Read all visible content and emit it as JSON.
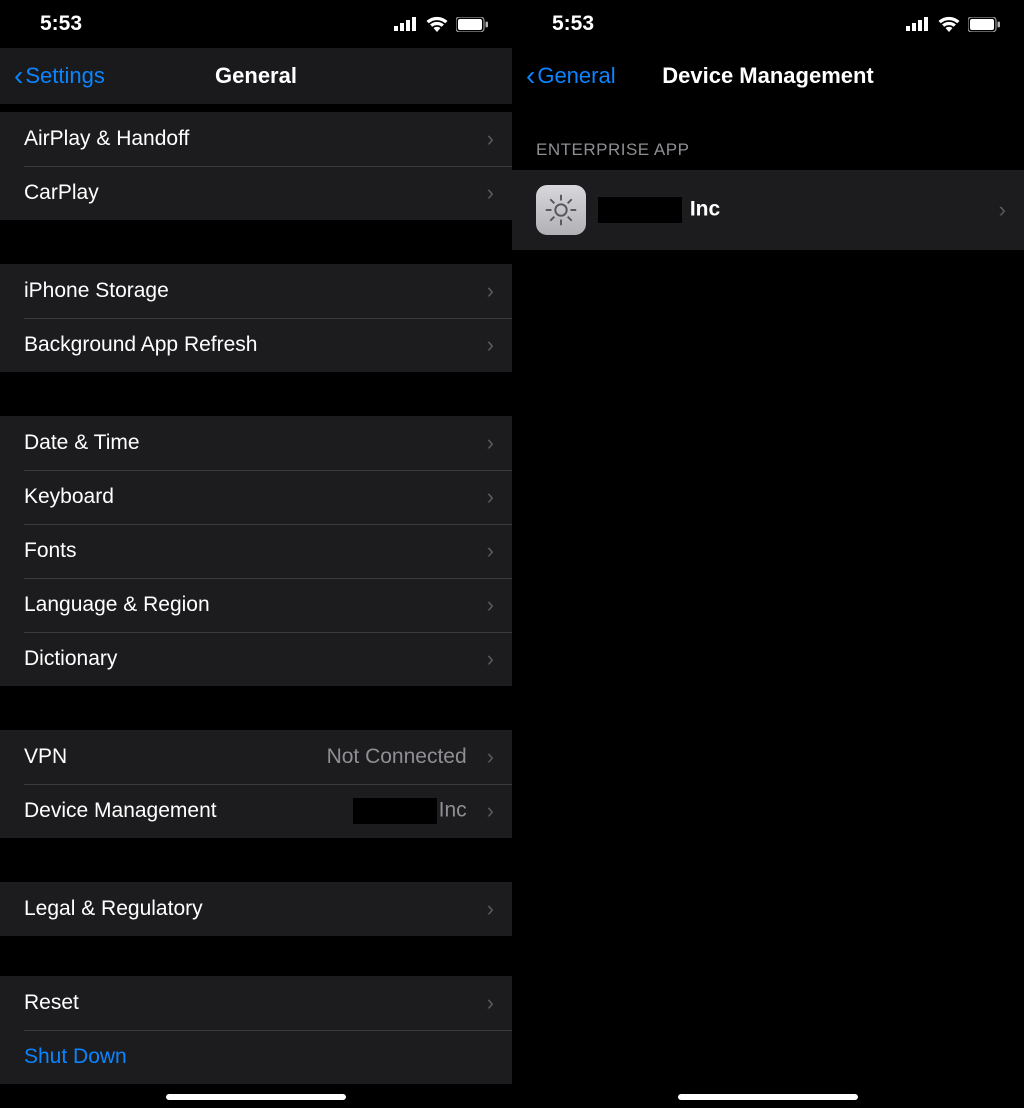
{
  "status": {
    "time": "5:53"
  },
  "left": {
    "back": "Settings",
    "title": "General",
    "groups": [
      [
        {
          "label": "AirPlay & Handoff"
        },
        {
          "label": "CarPlay"
        }
      ],
      [
        {
          "label": "iPhone Storage"
        },
        {
          "label": "Background App Refresh"
        }
      ],
      [
        {
          "label": "Date & Time"
        },
        {
          "label": "Keyboard"
        },
        {
          "label": "Fonts"
        },
        {
          "label": "Language & Region"
        },
        {
          "label": "Dictionary"
        }
      ],
      [
        {
          "label": "VPN",
          "value": "Not Connected"
        },
        {
          "label": "Device Management",
          "value_redacted_suffix": "Inc"
        }
      ],
      [
        {
          "label": "Legal & Regulatory"
        }
      ],
      [
        {
          "label": "Reset"
        },
        {
          "label": "Shut Down",
          "shutdown": true
        }
      ]
    ]
  },
  "right": {
    "back": "General",
    "title": "Device Management",
    "section_header": "ENTERPRISE APP",
    "enterprise_suffix": "Inc"
  }
}
